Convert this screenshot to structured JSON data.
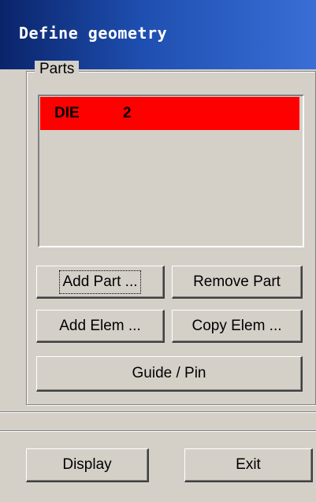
{
  "window": {
    "title": "Define geometry"
  },
  "parts": {
    "label": "Parts",
    "items": [
      {
        "name": "DIE",
        "number": "2",
        "color": "#ff0000"
      }
    ]
  },
  "buttons": {
    "add_part": "Add Part ...",
    "remove_part": "Remove Part",
    "add_elem": "Add Elem ...",
    "copy_elem": "Copy Elem ...",
    "guide_pin": "Guide / Pin",
    "display": "Display",
    "exit": "Exit"
  }
}
